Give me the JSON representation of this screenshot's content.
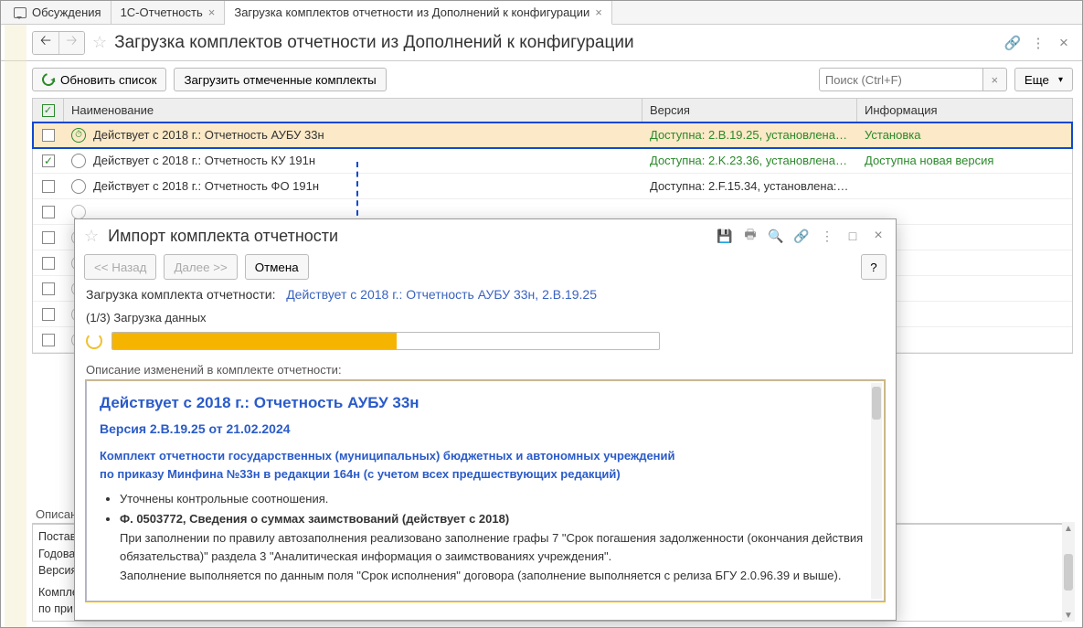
{
  "tabs": {
    "discussions": "Обсуждения",
    "t1": "1С-Отчетность",
    "t2": "Загрузка комплектов отчетности из Дополнений к конфигурации"
  },
  "header": {
    "title": "Загрузка комплектов отчетности из Дополнений к конфигурации"
  },
  "toolbar": {
    "refresh": "Обновить список",
    "load_selected": "Загрузить отмеченные комплекты",
    "search_placeholder": "Поиск (Ctrl+F)",
    "more": "Еще"
  },
  "table": {
    "headers": {
      "name": "Наименование",
      "version": "Версия",
      "info": "Информация"
    },
    "rows": [
      {
        "checked": false,
        "icon": "clock",
        "name": "Действует с 2018 г.: Отчетность АУБУ 33н",
        "version": "Доступна: 2.B.19.25, установлена…",
        "info": "Установка",
        "selected": true,
        "green": true
      },
      {
        "checked": true,
        "icon": "circle",
        "name": "Действует с 2018 г.: Отчетность КУ 191н",
        "version": "Доступна: 2.K.23.36, установлена…",
        "info": "Доступна новая версия",
        "green": true
      },
      {
        "checked": false,
        "icon": "circle",
        "name": "Действует с 2018 г.: Отчетность ФО 191н",
        "version": "Доступна: 2.F.15.34, установлена:…",
        "info": "",
        "green": false
      }
    ]
  },
  "bottom": {
    "label": "Описан",
    "l1": "Постав",
    "l2": "Годова",
    "l3": "Версия",
    "l4": "Компле",
    "l5": "по при"
  },
  "modal": {
    "title": "Импорт комплекта отчетности",
    "back": "<< Назад",
    "next": "Далее >>",
    "cancel": "Отмена",
    "loading_label": "Загрузка комплекта отчетности:",
    "loading_link": "Действует с 2018 г.: Отчетность АУБУ 33н, 2.B.19.25",
    "step": "(1/3) Загрузка данных",
    "progress_pct": 52,
    "changes_label": "Описание изменений в комплекте отчетности:",
    "h3": "Действует с 2018 г.: Отчетность АУБУ 33н",
    "h4": "Версия 2.В.19.25 от 21.02.2024",
    "bp1": "Комплект отчетности государственных (муниципальных) бюджетных и автономных учреждений",
    "bp2": "по приказу Минфина №33н в редакции 164н (с учетом всех предшествующих редакций)",
    "li1": "Уточнены контрольные соотношения.",
    "li2": "Ф. 0503772, Сведения о суммах заимствований (действует с 2018)",
    "li2a": "При заполнении по правилу автозаполнения реализовано заполнение графы 7 \"Срок погашения задолженности (окончания действия обязательства)\" раздела 3 \"Аналитическая информация о заимствованиях учреждения\".",
    "li2b": "Заполнение выполняется по данным поля \"Срок исполнения\" договора (заполнение выполняется с релиза БГУ 2.0.96.39 и выше)."
  }
}
